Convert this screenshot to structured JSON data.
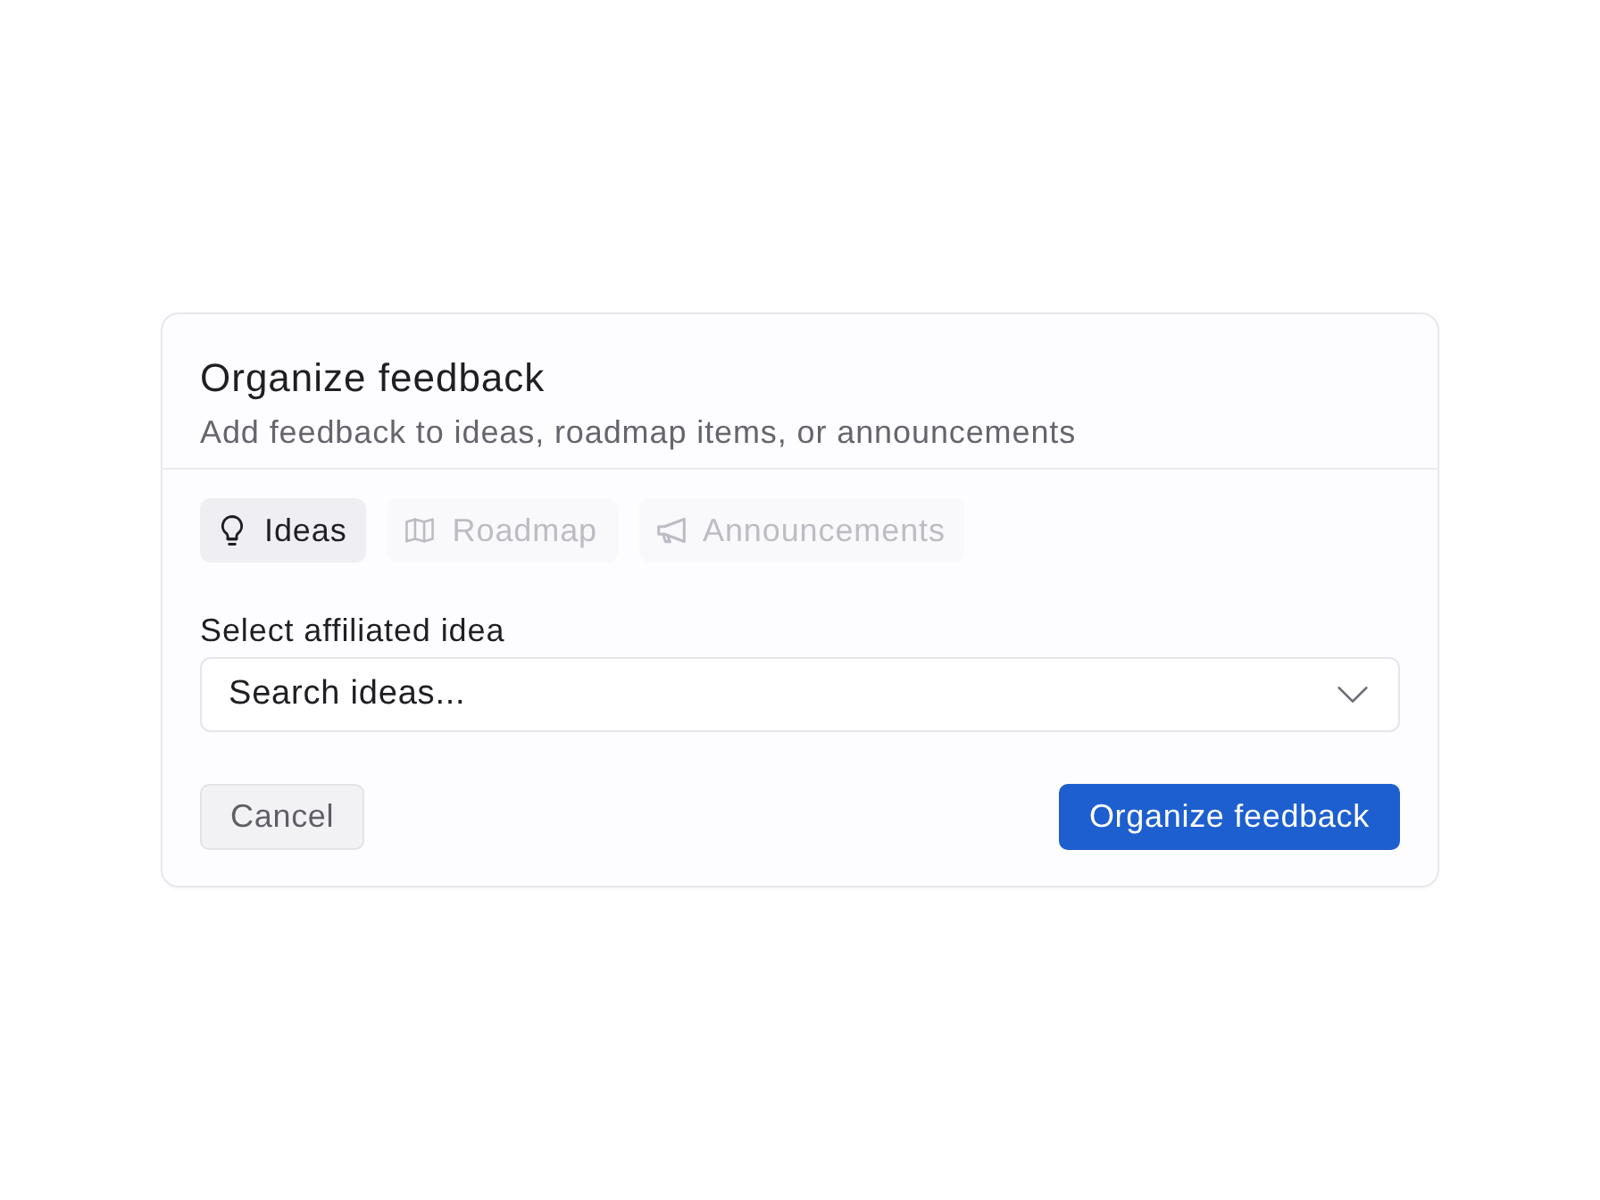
{
  "dialog": {
    "title": "Organize feedback",
    "subtitle": "Add feedback to ideas, roadmap items, or announcements"
  },
  "tabs": [
    {
      "kind": "idea",
      "label": "Ideas",
      "selected": true,
      "disabled": false
    },
    {
      "kind": "roadmap",
      "label": "Roadmap",
      "selected": false,
      "disabled": true
    },
    {
      "kind": "announcement",
      "label": "Announcements",
      "selected": false,
      "disabled": true
    }
  ],
  "field": {
    "label": "Select affiliated idea",
    "placeholder": "Search ideas..."
  },
  "buttons": [
    {
      "kind": "secondary",
      "label": "Cancel"
    },
    {
      "kind": "primary",
      "label": "Organize feedback"
    }
  ]
}
